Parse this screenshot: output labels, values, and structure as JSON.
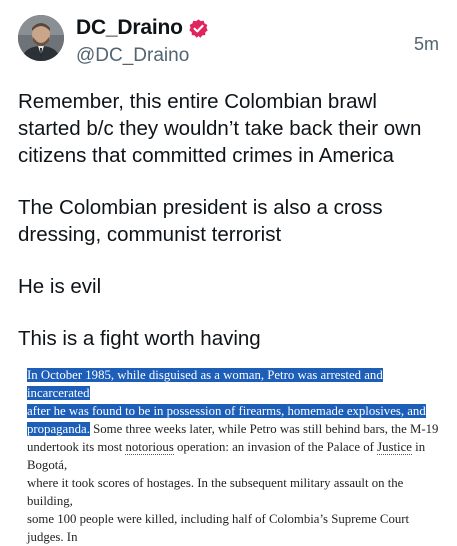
{
  "post": {
    "author": {
      "display_name": "DC_Draino",
      "handle": "@DC_Draino",
      "verified_icon": "verified-badge-icon",
      "badge_color": "#e0245e"
    },
    "timestamp": "5m",
    "paragraphs": [
      "Remember, this entire Colombian brawl\nstarted b/c they wouldn’t take back their own\ncitizens that committed crimes in America",
      "The Colombian president is also a cross\ndressing, communist terrorist",
      "He is evil",
      "This is a fight worth having"
    ],
    "excerpt": {
      "highlighted_1": "In October 1985, while disguised as a woman, Petro was arrested and incarcerated",
      "highlighted_2": "after he was found to be in possession of firearms, homemade explosives, and",
      "highlighted_3": "propaganda.",
      "part_1": " Some three weeks later, while Petro was still behind bars, the M-19",
      "part_2": "undertook its most ",
      "link_1": "notorious",
      "part_3": " operation: an invasion of the Palace of ",
      "link_2": "Justice",
      "part_4": " in Bogotá,",
      "line_5": "where it took scores of hostages. In the subsequent military assault on the building,",
      "line_6": "some 100 people were killed, including half of Colombia’s Supreme Court judges. In"
    },
    "highlight_color": "#1d5fb8"
  }
}
